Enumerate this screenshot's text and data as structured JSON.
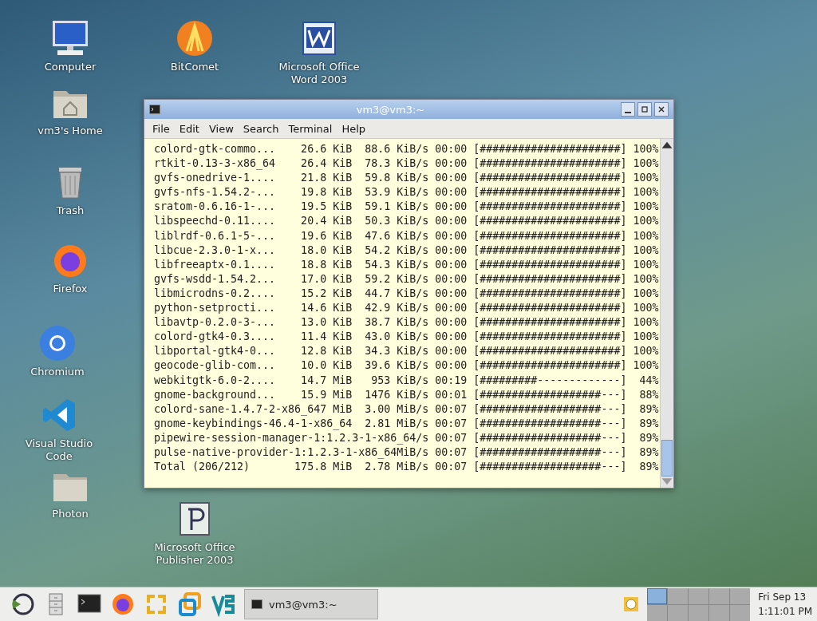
{
  "desktop_icons": [
    {
      "kind": "computer",
      "label": "Computer"
    },
    {
      "kind": "bitcomet",
      "label": "BitComet"
    },
    {
      "kind": "word",
      "label": "Microsoft Office Word 2003"
    },
    {
      "kind": "home",
      "label": "vm3's Home"
    },
    {
      "kind": "trash",
      "label": "Trash"
    },
    {
      "kind": "firefox",
      "label": "Firefox"
    },
    {
      "kind": "chromium",
      "label": "Chromium"
    },
    {
      "kind": "vscode",
      "label": "Visual Studio Code"
    },
    {
      "kind": "folder",
      "label": "Photon"
    },
    {
      "kind": "publisher",
      "label": "Microsoft Office Publisher 2003"
    }
  ],
  "window": {
    "title": "vm3@vm3:~",
    "menu": [
      "File",
      "Edit",
      "View",
      "Search",
      "Terminal",
      "Help"
    ],
    "lines": [
      "colord-gtk-commo...    26.6 KiB  88.6 KiB/s 00:00 [######################] 100%",
      "rtkit-0.13-3-x86_64    26.4 KiB  78.3 KiB/s 00:00 [######################] 100%",
      "gvfs-onedrive-1....    21.8 KiB  59.8 KiB/s 00:00 [######################] 100%",
      "gvfs-nfs-1.54.2-...    19.8 KiB  53.9 KiB/s 00:00 [######################] 100%",
      "sratom-0.6.16-1-...    19.5 KiB  59.1 KiB/s 00:00 [######################] 100%",
      "libspeechd-0.11....    20.4 KiB  50.3 KiB/s 00:00 [######################] 100%",
      "liblrdf-0.6.1-5-...    19.6 KiB  47.6 KiB/s 00:00 [######################] 100%",
      "libcue-2.3.0-1-x...    18.0 KiB  54.2 KiB/s 00:00 [######################] 100%",
      "libfreeaptx-0.1....    18.8 KiB  54.3 KiB/s 00:00 [######################] 100%",
      "gvfs-wsdd-1.54.2...    17.0 KiB  59.2 KiB/s 00:00 [######################] 100%",
      "libmicrodns-0.2....    15.2 KiB  44.7 KiB/s 00:00 [######################] 100%",
      "python-setprocti...    14.6 KiB  42.9 KiB/s 00:00 [######################] 100%",
      "libavtp-0.2.0-3-...    13.0 KiB  38.7 KiB/s 00:00 [######################] 100%",
      "colord-gtk4-0.3....    11.4 KiB  43.0 KiB/s 00:00 [######################] 100%",
      "libportal-gtk4-0...    12.8 KiB  34.3 KiB/s 00:00 [######################] 100%",
      "geocode-glib-com...    10.0 KiB  39.6 KiB/s 00:00 [######################] 100%",
      "webkitgtk-6.0-2....    14.7 MiB   953 KiB/s 00:19 [#########-------------]  44%",
      "gnome-background...    15.9 MiB  1476 KiB/s 00:01 [###################---]  88%",
      "colord-sane-1.4.7-2-x86_647 MiB  3.00 MiB/s 00:07 [###################---]  89%",
      "gnome-keybindings-46.4-1-x86_64  2.81 MiB/s 00:07 [###################---]  89%",
      "pipewire-session-manager-1:1.2.3-1-x86_64/s 00:07 [###################---]  89%",
      "pulse-native-provider-1:1.2.3-1-x86_64MiB/s 00:07 [###################---]  89%",
      "Total (206/212)       175.8 MiB  2.78 MiB/s 00:07 [###################---]  89%"
    ]
  },
  "taskbar": {
    "launchers": [
      {
        "kind": "menu"
      },
      {
        "kind": "files"
      },
      {
        "kind": "terminal"
      },
      {
        "kind": "firefox"
      },
      {
        "kind": "vmware"
      },
      {
        "kind": "vbox"
      },
      {
        "kind": "vs"
      }
    ],
    "task": {
      "label": "vm3@vm3:~"
    },
    "workspaces": [
      {
        "selected": true
      },
      {
        "selected": false
      },
      {
        "selected": false
      },
      {
        "selected": false
      },
      {
        "selected": false
      },
      {
        "selected": false
      },
      {
        "selected": false
      },
      {
        "selected": false
      },
      {
        "selected": false
      },
      {
        "selected": false
      }
    ],
    "clock": {
      "date": "Fri Sep 13",
      "time": "1:11:01 PM"
    }
  }
}
